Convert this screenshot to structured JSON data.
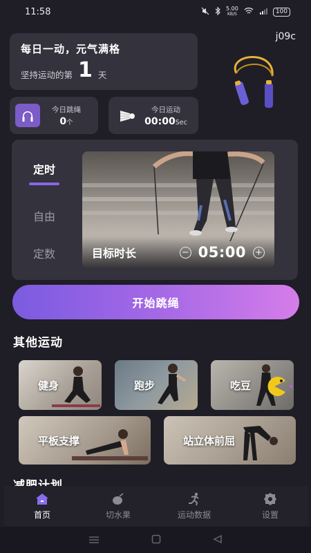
{
  "status_bar": {
    "time": "11:58",
    "speed_value": "5.00",
    "speed_unit": "KB/S",
    "battery": "100"
  },
  "daily": {
    "title": "每日一动，元气满格",
    "streak_prefix": "坚持运动的第",
    "streak_days": "1",
    "streak_suffix": "天"
  },
  "user": {
    "name": "j09c"
  },
  "stats": {
    "jump": {
      "label": "今日跳绳",
      "value": "0",
      "unit": "个",
      "icon": "jump-rope-icon"
    },
    "sport": {
      "label": "今日运动",
      "value": "00:00",
      "unit": "Sec",
      "icon": "shuttlecock-icon"
    }
  },
  "modes": {
    "tabs": [
      "定时",
      "自由",
      "定数"
    ],
    "active": "定时"
  },
  "timer": {
    "label": "目标时长",
    "value": "05:00",
    "minus": "−",
    "plus": "+"
  },
  "start_button": "开始跳绳",
  "other_sports": {
    "title": "其他运动",
    "items": [
      "健身",
      "跑步",
      "吃豆",
      "平板支撑",
      "站立体前屈"
    ]
  },
  "plan_section": {
    "title": "减肥计划"
  },
  "bottom_nav": [
    {
      "label": "首页",
      "icon": "home-icon",
      "active": true
    },
    {
      "label": "切水果",
      "icon": "fruit-icon",
      "active": false
    },
    {
      "label": "运动数据",
      "icon": "running-icon",
      "active": false
    },
    {
      "label": "设置",
      "icon": "gear-icon",
      "active": false
    }
  ],
  "colors": {
    "accent": "#8668e6",
    "button_start": "#7b5be0",
    "button_end": "#d57de9",
    "background": "#1f1e26",
    "card": "#33323d"
  }
}
